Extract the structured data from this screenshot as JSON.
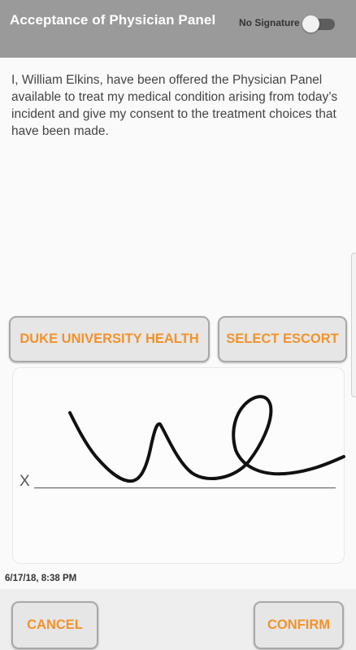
{
  "header": {
    "title": "Acceptance of Physician Panel",
    "no_signature_label": "No Signature",
    "no_signature_toggle": "off"
  },
  "consent_text": "I, William Elkins, have been offered the Physician Panel available to treat my medical condition arising from today’s incident and give my consent to the treatment choices that have been made.",
  "panel_buttons": {
    "physician": "DUKE UNIVERSITY HEALTH",
    "escort": "SELECT ESCORT"
  },
  "signature": {
    "x_mark": "X",
    "timestamp": "6/17/18, 8:38 PM"
  },
  "footer": {
    "cancel_label": "CANCEL",
    "confirm_label": "CONFIRM"
  },
  "colors": {
    "header_bg": "#9a9a9a",
    "accent_orange": "#f0932b",
    "button_bg": "#e6e6e6"
  }
}
